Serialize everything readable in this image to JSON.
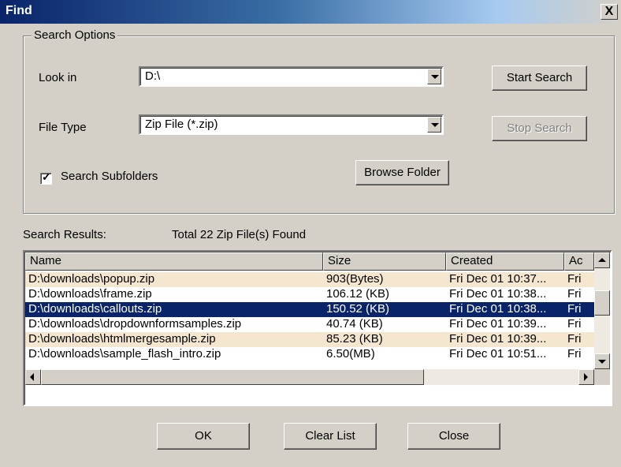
{
  "window": {
    "title": "Find",
    "close_glyph": "X"
  },
  "search_options": {
    "group_label": "Search Options",
    "look_in_label": "Look in",
    "look_in_value": "D:\\",
    "file_type_label": "File Type",
    "file_type_value": "Zip File (*.zip)",
    "subfolders_label": "Search Subfolders",
    "subfolders_checked": true,
    "start_search": "Start Search",
    "stop_search": "Stop Search",
    "browse_folder": "Browse Folder"
  },
  "results": {
    "label": "Search Results:",
    "summary": "Total 22 Zip File(s) Found",
    "columns": [
      "Name",
      "Size",
      "Created",
      "Ac"
    ],
    "rows": [
      {
        "name": "D:\\downloads\\popup.zip",
        "size": "903(Bytes)",
        "created": "Fri Dec 01 10:37...",
        "accessed": "Fri"
      },
      {
        "name": "D:\\downloads\\frame.zip",
        "size": "106.12 (KB)",
        "created": "Fri Dec 01 10:38...",
        "accessed": "Fri"
      },
      {
        "name": "D:\\downloads\\callouts.zip",
        "size": "150.52 (KB)",
        "created": "Fri Dec 01 10:38...",
        "accessed": "Fri"
      },
      {
        "name": "D:\\downloads\\dropdownformsamples.zip",
        "size": "40.74 (KB)",
        "created": "Fri Dec 01 10:39...",
        "accessed": "Fri"
      },
      {
        "name": "D:\\downloads\\htmlmergesample.zip",
        "size": "85.23 (KB)",
        "created": "Fri Dec 01 10:39...",
        "accessed": "Fri"
      },
      {
        "name": "D:\\downloads\\sample_flash_intro.zip",
        "size": "6.50(MB)",
        "created": "Fri Dec 01 10:51...",
        "accessed": "Fri"
      }
    ],
    "selected_index": 2
  },
  "footer": {
    "ok": "OK",
    "clear_list": "Clear List",
    "close": "Close"
  },
  "colors": {
    "title_bar": "#0a246a",
    "selection": "#0a246a",
    "alt_row": "#f5e6d0",
    "face": "#d4d0c8"
  }
}
